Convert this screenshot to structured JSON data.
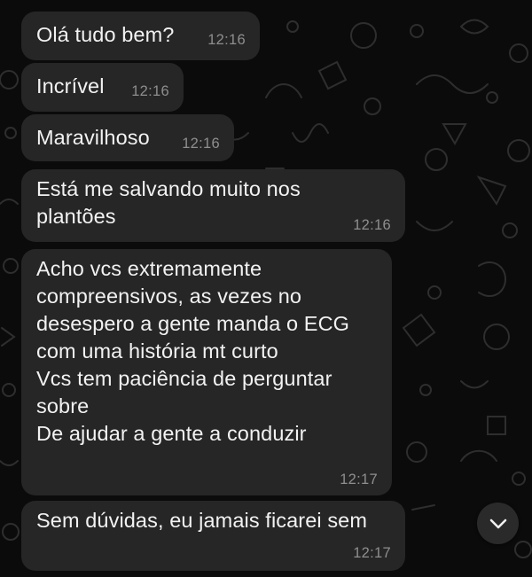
{
  "colors": {
    "background": "#0b0b0b",
    "bubble": "#262626",
    "text": "#f2f2f2",
    "timestamp": "#8e8e8e",
    "scroll_button": "#2a2a2a"
  },
  "messages": [
    {
      "text": "Olá tudo bem?",
      "time": "12:16"
    },
    {
      "text": "Incrível",
      "time": "12:16"
    },
    {
      "text": "Maravilhoso",
      "time": "12:16"
    },
    {
      "text": "Está me salvando muito nos\nplantões",
      "time": "12:16"
    },
    {
      "text": "Acho vcs extremamente\ncompreensivos, as vezes no\ndesespero a gente manda o ECG\ncom uma história mt curto\nVcs tem paciência de perguntar\nsobre\nDe ajudar a gente a conduzir",
      "time": "12:17"
    },
    {
      "text": "Sem dúvidas, eu jamais ficarei sem",
      "time": "12:17"
    }
  ],
  "scroll_button": {
    "icon": "chevron-down-icon"
  }
}
